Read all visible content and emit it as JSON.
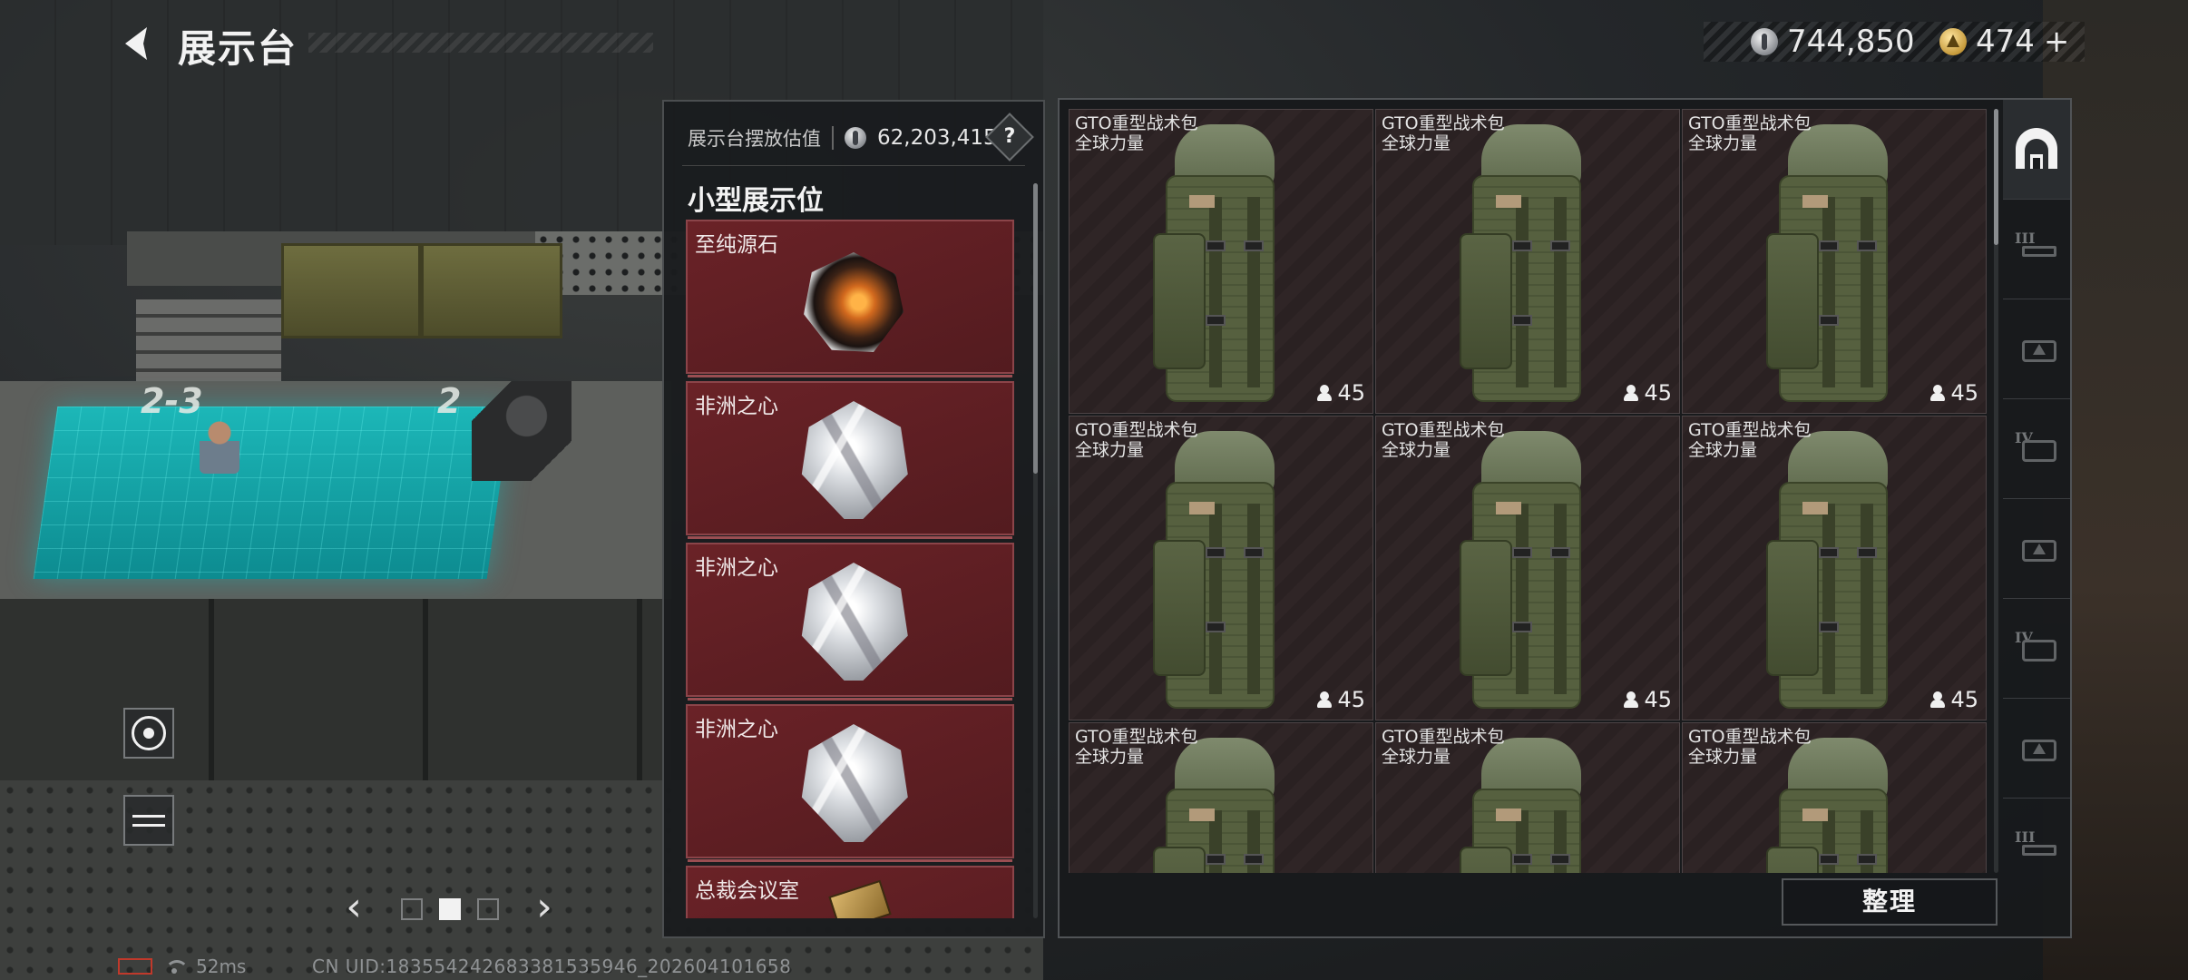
{
  "header": {
    "title": "展示台",
    "back_icon": "chevron-left-icon"
  },
  "currencies": [
    {
      "icon": "silver-coin-icon",
      "value": "744,850"
    },
    {
      "icon": "gold-triangle-coin-icon",
      "value": "474",
      "suffix": "+"
    }
  ],
  "scene": {
    "labels": [
      "2-3",
      "2"
    ]
  },
  "display_panel": {
    "valuation_label": "展示台摆放估值",
    "valuation_icon": "silver-coin-icon",
    "valuation_value": "62,203,415",
    "help_label": "?",
    "section_title": "小型展示位",
    "slots": [
      {
        "name": "至纯源石",
        "icon": "orange-crystal-gem-icon"
      },
      {
        "name": "非洲之心",
        "icon": "diamond-icon"
      },
      {
        "name": "非洲之心",
        "icon": "diamond-icon"
      },
      {
        "name": "非洲之心",
        "icon": "diamond-icon"
      },
      {
        "name": "总裁会议室",
        "icon": "keycard-icon"
      }
    ]
  },
  "inventory": {
    "items": [
      {
        "name": "GTO重型战术包",
        "sub": "全球力量",
        "count": "45"
      },
      {
        "name": "GTO重型战术包",
        "sub": "全球力量",
        "count": "45"
      },
      {
        "name": "GTO重型战术包",
        "sub": "全球力量",
        "count": "45"
      },
      {
        "name": "GTO重型战术包",
        "sub": "全球力量",
        "count": "45"
      },
      {
        "name": "GTO重型战术包",
        "sub": "全球力量",
        "count": "45"
      },
      {
        "name": "GTO重型战术包",
        "sub": "全球力量",
        "count": "45"
      },
      {
        "name": "GTO重型战术包",
        "sub": "全球力量",
        "count": ""
      },
      {
        "name": "GTO重型战术包",
        "sub": "全球力量",
        "count": ""
      },
      {
        "name": "GTO重型战术包",
        "sub": "全球力量",
        "count": ""
      }
    ],
    "arrange_label": "整理",
    "side_tabs": [
      {
        "icon": "display-stand-icon",
        "roman": "",
        "active": true
      },
      {
        "icon": "weapon-tier-3-icon",
        "roman": "III"
      },
      {
        "icon": "warning-case-icon",
        "roman": ""
      },
      {
        "icon": "folder-tier-4-icon",
        "roman": "IV"
      },
      {
        "icon": "warning-case-icon",
        "roman": ""
      },
      {
        "icon": "folder-tier-4-icon",
        "roman": "IV"
      },
      {
        "icon": "warning-case-icon",
        "roman": ""
      },
      {
        "icon": "weapon-tier-3-icon",
        "roman": "III"
      }
    ]
  },
  "controls": {
    "eye_icon": "eye-icon",
    "swap_icon": "swap-icon",
    "pager": {
      "pages": 3,
      "current": 2
    }
  },
  "status": {
    "ping": "52ms",
    "uid": "CN UID:1835542426833815359​46_202604101658"
  }
}
